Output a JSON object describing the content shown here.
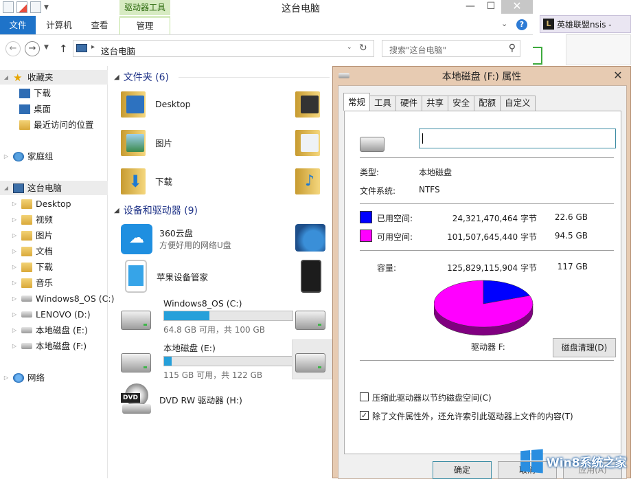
{
  "window": {
    "title": "这台电脑",
    "context_tab": "驱动器工具"
  },
  "ribbon": {
    "tabs": [
      "文件",
      "计算机",
      "查看",
      "管理"
    ],
    "help": "?"
  },
  "address": {
    "path": "这台电脑",
    "search_placeholder": "搜索\"这台电脑\""
  },
  "taskbar": {
    "label": "英雄联盟nsis -"
  },
  "nav": {
    "favorites": "收藏夹",
    "fav_items": [
      "下载",
      "桌面",
      "最近访问的位置"
    ],
    "homegroup": "家庭组",
    "this_pc": "这台电脑",
    "pc_items": [
      "Desktop",
      "视频",
      "图片",
      "文档",
      "下载",
      "音乐",
      "Windows8_OS (C:)",
      "LENOVO (D:)",
      "本地磁盘 (E:)",
      "本地磁盘 (F:)"
    ],
    "network": "网络"
  },
  "content": {
    "folders_header": "文件夹 (6)",
    "folders": [
      "Desktop",
      "图片",
      "下载"
    ],
    "devices_header": "设备和驱动器 (9)",
    "devices": [
      {
        "name": "360云盘",
        "sub": "方便好用的网络U盘"
      },
      {
        "name": "苹果设备管家",
        "sub": ""
      },
      {
        "name": "Windows8_OS (C:)",
        "sub": "64.8 GB 可用，共 100 GB",
        "fill": 0.352
      },
      {
        "name": "本地磁盘 (E:)",
        "sub": "115 GB 可用，共 122 GB",
        "fill": 0.057
      },
      {
        "name": "DVD RW 驱动器 (H:)",
        "sub": ""
      }
    ],
    "dvd_label": "DVD"
  },
  "dialog": {
    "title": "本地磁盘 (F:) 属性",
    "tabs": [
      "常规",
      "工具",
      "硬件",
      "共享",
      "安全",
      "配额",
      "自定义"
    ],
    "type_label": "类型:",
    "type_value": "本地磁盘",
    "fs_label": "文件系统:",
    "fs_value": "NTFS",
    "used_label": "已用空间:",
    "used_bytes": "24,321,470,464 字节",
    "used_size": "22.6 GB",
    "free_label": "可用空间:",
    "free_bytes": "101,507,645,440 字节",
    "free_size": "94.5 GB",
    "capacity_label": "容量:",
    "capacity_bytes": "125,829,115,904 字节",
    "capacity_size": "117 GB",
    "used_color": "#0000ff",
    "free_color": "#ff00ff",
    "used_fraction": 0.193,
    "drive_label": "驱动器 F:",
    "cleanup_button": "磁盘清理(D)",
    "compress_label": "压缩此驱动器以节约磁盘空间(C)",
    "compress_checked": false,
    "index_label": "除了文件属性外，还允许索引此驱动器上文件的内容(T)",
    "index_checked": true,
    "ok": "确定",
    "cancel": "取消",
    "apply": "应用(A)"
  },
  "watermark": {
    "text": "Win8系统之家"
  }
}
